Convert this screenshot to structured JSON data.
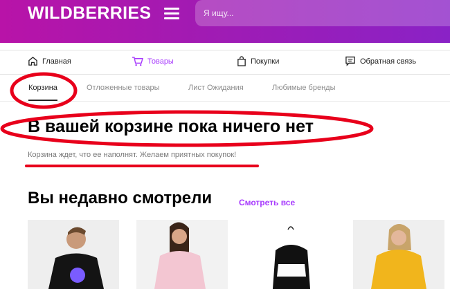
{
  "header": {
    "logo": "WILDBERRIES",
    "search_placeholder": "Я ищу..."
  },
  "nav": {
    "items": [
      {
        "label": "Главная",
        "icon": "home-icon"
      },
      {
        "label": "Товары",
        "icon": "cart-icon",
        "active": true
      },
      {
        "label": "Покупки",
        "icon": "bag-icon"
      },
      {
        "label": "Обратная связь",
        "icon": "chat-icon"
      }
    ]
  },
  "tabs": [
    {
      "label": "Корзина",
      "active": true
    },
    {
      "label": "Отложенные товары"
    },
    {
      "label": "Лист Ожидания"
    },
    {
      "label": "Любимые бренды"
    }
  ],
  "cart": {
    "title": "В вашей корзине пока ничего нет",
    "subtitle": "Корзина ждет, что ее наполнят. Желаем приятных покупок!"
  },
  "recent": {
    "title": "Вы недавно смотрели",
    "see_all": "Смотреть все"
  },
  "colors": {
    "brand_start": "#b813a8",
    "brand_end": "#8a22c6",
    "accent": "#a73afd",
    "annotation": "#e8001b"
  }
}
